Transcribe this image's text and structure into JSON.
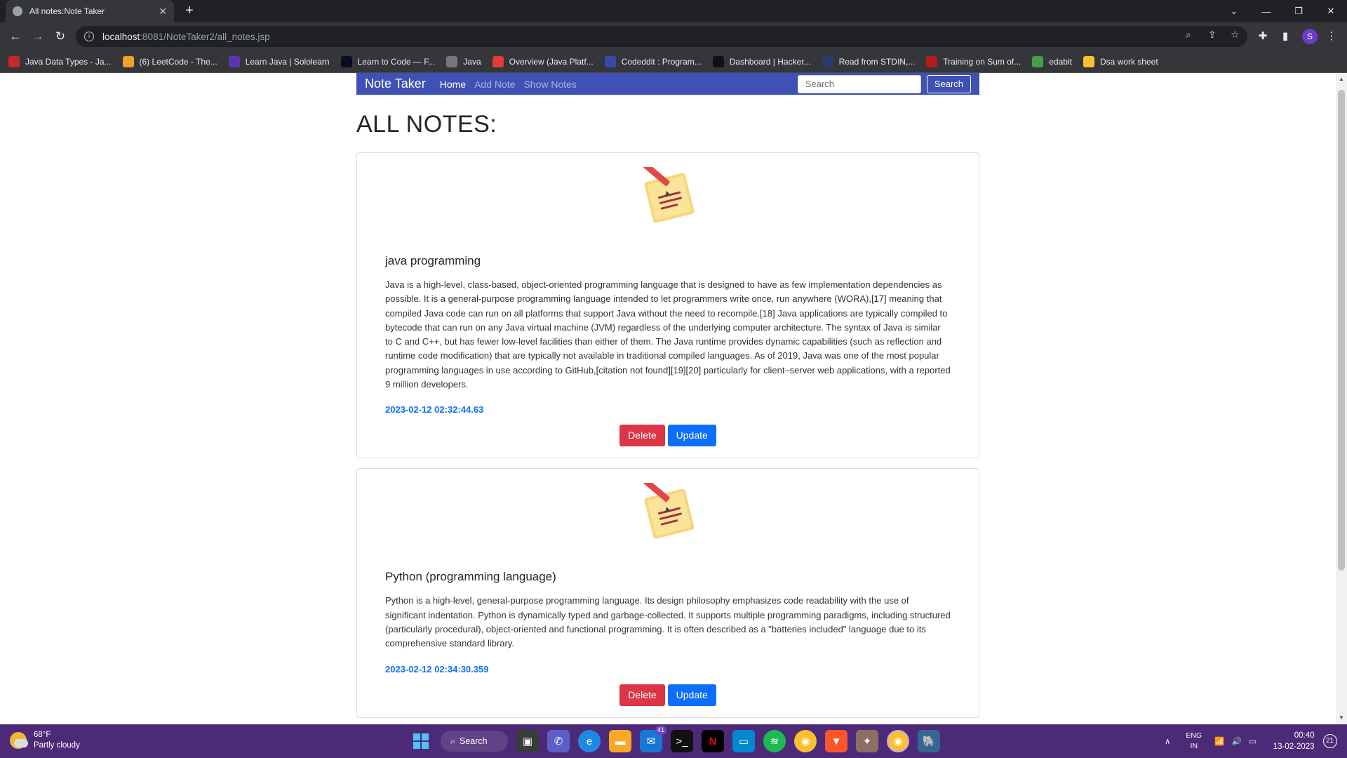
{
  "browser": {
    "tab_title": "All notes:Note Taker",
    "url_host": "localhost",
    "url_path": ":8081/NoteTaker2/all_notes.jsp",
    "profile_initial": "S",
    "bookmarks": [
      {
        "label": "Java Data Types - Ja...",
        "color": "#c62828"
      },
      {
        "label": "(6) LeetCode - The...",
        "color": "#f0a12b"
      },
      {
        "label": "Learn Java | Sololearn",
        "color": "#5e35b1"
      },
      {
        "label": "Learn to Code — F...",
        "color": "#0a0a23"
      },
      {
        "label": "Java",
        "color": "#777777"
      },
      {
        "label": "Overview (Java Platf...",
        "color": "#e53935"
      },
      {
        "label": "Codeddit : Program...",
        "color": "#3949ab"
      },
      {
        "label": "Dashboard | Hacker...",
        "color": "#111111"
      },
      {
        "label": "Read from STDIN,...",
        "color": "#2a3b6b"
      },
      {
        "label": "Training on Sum of...",
        "color": "#b71c1c"
      },
      {
        "label": "edabit",
        "color": "#43a047"
      },
      {
        "label": "Dsa work sheet",
        "color": "#fbc02d"
      }
    ]
  },
  "app": {
    "brand": "Note Taker",
    "nav": {
      "home": "Home",
      "add_note": "Add Note",
      "show_notes": "Show Notes"
    },
    "search_placeholder": "Search",
    "search_button": "Search",
    "heading": "ALL NOTES:"
  },
  "notes": [
    {
      "title": "java programming",
      "content": "Java is a high-level, class-based, object-oriented programming language that is designed to have as few implementation dependencies as possible. It is a general-purpose programming language intended to let programmers write once, run anywhere (WORA),[17] meaning that compiled Java code can run on all platforms that support Java without the need to recompile.[18] Java applications are typically compiled to bytecode that can run on any Java virtual machine (JVM) regardless of the underlying computer architecture. The syntax of Java is similar to C and C++, but has fewer low-level facilities than either of them. The Java runtime provides dynamic capabilities (such as reflection and runtime code modification) that are typically not available in traditional compiled languages. As of 2019, Java was one of the most popular programming languages in use according to GitHub,[citation not found][19][20] particularly for client–server web applications, with a reported 9 million developers.",
      "date": "2023-02-12 02:32:44.63",
      "delete_label": "Delete",
      "update_label": "Update"
    },
    {
      "title": "Python (programming language)",
      "content": "Python is a high-level, general-purpose programming language. Its design philosophy emphasizes code readability with the use of significant indentation. Python is dynamically typed and garbage-collected. It supports multiple programming paradigms, including structured (particularly procedural), object-oriented and functional programming. It is often described as a \"batteries included\" language due to its comprehensive standard library.",
      "date": "2023-02-12 02:34:30.359",
      "delete_label": "Delete",
      "update_label": "Update"
    }
  ],
  "taskbar": {
    "weather_temp": "68°F",
    "weather_desc": "Partly cloudy",
    "search_label": "Search",
    "mail_badge": "41",
    "lang_top": "ENG",
    "lang_bottom": "IN",
    "time": "00:40",
    "date": "13-02-2023",
    "notification_count": "21"
  },
  "colors": {
    "navbar": "#3f51b5",
    "danger": "#dc3545",
    "primary": "#0d6efd",
    "taskbar": "#4d2a78"
  }
}
